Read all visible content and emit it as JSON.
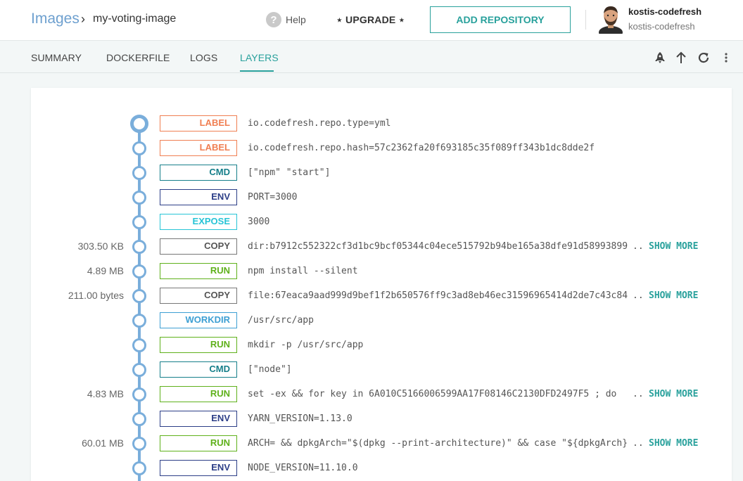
{
  "breadcrumb": {
    "root": "Images",
    "separator": "›",
    "current": "my-voting-image"
  },
  "header": {
    "help": "Help",
    "upgrade": "⋆ UPGRADE ⋆",
    "add_repository": "ADD REPOSITORY"
  },
  "user": {
    "name": "kostis-codefresh",
    "account": "kostis-codefresh"
  },
  "tabs": [
    {
      "label": "SUMMARY"
    },
    {
      "label": "DOCKERFILE"
    },
    {
      "label": "LOGS"
    },
    {
      "label": "LAYERS",
      "active": true
    }
  ],
  "toolbar_icons": [
    "rocket-icon",
    "arrow-up-icon",
    "refresh-icon",
    "more-vertical-icon"
  ],
  "colors": {
    "accent": "#29a19c",
    "timeline": "#7aaedb",
    "LABEL": "#f07f52",
    "CMD": "#167f8a",
    "ENV": "#2c3e87",
    "EXPOSE": "#27c4d6",
    "COPY": "#777777",
    "RUN": "#5fb11b",
    "WORKDIR": "#3d9fd3"
  },
  "show_more_label": "SHOW MORE",
  "ellipsis": "..",
  "layers": [
    {
      "size": "",
      "type": "LABEL",
      "command": "io.codefresh.repo.type=yml",
      "truncated": false
    },
    {
      "size": "",
      "type": "LABEL",
      "command": "io.codefresh.repo.hash=57c2362fa20f693185c35f089ff343b1dc8dde2f",
      "truncated": false
    },
    {
      "size": "",
      "type": "CMD",
      "command": "[\"npm\" \"start\"]",
      "truncated": false
    },
    {
      "size": "",
      "type": "ENV",
      "command": "PORT=3000",
      "truncated": false
    },
    {
      "size": "",
      "type": "EXPOSE",
      "command": "3000",
      "truncated": false
    },
    {
      "size": "303.50 KB",
      "type": "COPY",
      "command": "dir:b7912c552322cf3d1bc9bcf05344c04ece515792b94be165a38dfe91d58993899",
      "truncated": true
    },
    {
      "size": "4.89 MB",
      "type": "RUN",
      "command": "npm install --silent",
      "truncated": false
    },
    {
      "size": "211.00 bytes",
      "type": "COPY",
      "command": "file:67eaca9aad999d9bef1f2b650576ff9c3ad8eb46ec31596965414d2de7c43c84",
      "truncated": true
    },
    {
      "size": "",
      "type": "WORKDIR",
      "command": "/usr/src/app",
      "truncated": false
    },
    {
      "size": "",
      "type": "RUN",
      "command": "mkdir -p /usr/src/app",
      "truncated": false
    },
    {
      "size": "",
      "type": "CMD",
      "command": "[\"node\"]",
      "truncated": false
    },
    {
      "size": "4.83 MB",
      "type": "RUN",
      "command": "set -ex && for key in 6A010C5166006599AA17F08146C2130DFD2497F5 ; do",
      "truncated": true
    },
    {
      "size": "",
      "type": "ENV",
      "command": "YARN_VERSION=1.13.0",
      "truncated": false
    },
    {
      "size": "60.01 MB",
      "type": "RUN",
      "command": "ARCH= && dpkgArch=\"$(dpkg --print-architecture)\" && case \"${dpkgArch}",
      "truncated": true
    },
    {
      "size": "",
      "type": "ENV",
      "command": "NODE_VERSION=11.10.0",
      "truncated": false
    }
  ]
}
